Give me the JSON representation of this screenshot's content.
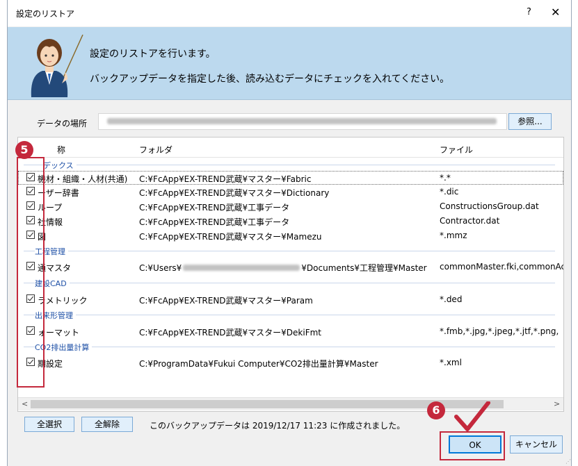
{
  "window": {
    "title": "設定のリストア",
    "help": "?",
    "close": "✕"
  },
  "banner": {
    "line1": "設定のリストアを行います。",
    "line2": "バックアップデータを指定した後、読み込むデータにチェックを入れてください。"
  },
  "location": {
    "label": "データの場所",
    "browse": "参照..."
  },
  "columns": {
    "name": "称",
    "folder": "フォルダ",
    "file": "ファイル"
  },
  "groups": [
    "デックス",
    "工程管理",
    "建設CAD",
    "出来形管理",
    "CO2排出量計算"
  ],
  "rows": [
    {
      "name": "機材・組織・人材(共通)",
      "folder": "C:¥FcApp¥EX-TREND武蔵¥マスター¥Fabric",
      "file": "*.*",
      "checked": true
    },
    {
      "name": "ーザー辞書",
      "folder": "C:¥FcApp¥EX-TREND武蔵¥マスター¥Dictionary",
      "file": "*.dic",
      "checked": true
    },
    {
      "name": "ループ",
      "folder": "C:¥FcApp¥EX-TREND武蔵¥工事データ",
      "file": "ConstructionsGroup.dat",
      "checked": true
    },
    {
      "name": "社情報",
      "folder": "C:¥FcApp¥EX-TREND武蔵¥工事データ",
      "file": "Contractor.dat",
      "checked": true
    },
    {
      "name": "図",
      "folder": "C:¥FcApp¥EX-TREND武蔵¥マスター¥Mamezu",
      "file": "*.mmz",
      "checked": true
    },
    {
      "name": "通マスタ",
      "folder_pre": "C:¥Users¥",
      "folder_post": "¥Documents¥工程管理¥Master",
      "file": "commonMaster.fki,commonAc",
      "checked": true
    },
    {
      "name": "ラメトリック",
      "folder": "C:¥FcApp¥EX-TREND武蔵¥マスター¥Param",
      "file": "*.ded",
      "checked": true
    },
    {
      "name": "ォーマット",
      "folder": "C:¥FcApp¥EX-TREND武蔵¥マスター¥DekiFmt",
      "file": "*.fmb,*.jpg,*.jpeg,*.jtf,*.png,",
      "checked": true
    },
    {
      "name": "期設定",
      "folder": "C:¥ProgramData¥Fukui Computer¥CO2排出量計算¥Master",
      "file": "*.xml",
      "checked": true
    }
  ],
  "scroll": {
    "left": "<",
    "right": ">"
  },
  "footer": {
    "select_all": "全選択",
    "deselect_all": "全解除",
    "info": "このバックアップデータは 2019/12/17 11:23 に作成されました。",
    "ok": "OK",
    "cancel": "キャンセル"
  },
  "annotations": {
    "step5": "5",
    "step6": "6",
    "color": "#c4283c"
  },
  "colors": {
    "banner": "#bcd9ee",
    "group_text": "#1d4fa6",
    "button": "#e1effb"
  },
  "icons": [
    "help-icon",
    "close-icon",
    "avatar-icon",
    "checkbox-icon",
    "check-mark-icon"
  ]
}
